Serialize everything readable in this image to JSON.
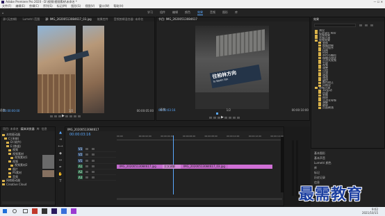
{
  "window": {
    "title": "Adobe Premiere Pro 2020 - D:\\视频\\视频素材\\未命名 *"
  },
  "menu": [
    "文件(F)",
    "编辑(E)",
    "剪辑(C)",
    "序列(S)",
    "标记(M)",
    "图形(G)",
    "视图(V)",
    "窗口(W)",
    "帮助(H)"
  ],
  "workspaces": [
    "学习",
    "组件",
    "编辑",
    "颜色",
    "效果",
    "音频",
    "图形",
    "库"
  ],
  "active_workspace": "效果",
  "source": {
    "tabs": [
      "源:(无剪辑)",
      "Lumetri 范围",
      "源: IMG_20200513084617_03.jpg",
      "效果控件",
      "音频剪辑混合器: 未命名"
    ],
    "timecode": "00:00:00:00",
    "fit": "适合",
    "ratio": "1/2",
    "end": "00:00:05:00"
  },
  "program": {
    "tab": "节目: IMG_20200513084617",
    "timecode": "00:00:03:16",
    "fit": "适合",
    "ratio": "1/2",
    "end": "00:00:10:00",
    "sign": "往柏林方向",
    "sign_sub": "to Berlin Stn"
  },
  "effects": {
    "title": "效果",
    "items": [
      "预设",
      "Lumetri 预设",
      "音频效果",
      "音频过渡",
      "视频效果",
      "变换",
      "图像控制",
      "实用程序",
      "扭曲",
      "时间",
      "杂色与颗粒",
      "模糊与锐化",
      "沉浸式视频",
      "生成",
      "视频",
      "调整",
      "过时",
      "过渡",
      "透视",
      "通道",
      "键控",
      "颜色校正",
      "风格化",
      "视频过渡",
      "3D运动",
      "内滑",
      "划像",
      "擦除",
      "沉浸式视频",
      "溶解",
      "缩放",
      "页面剥落"
    ]
  },
  "bottom_right": [
    "基本图形",
    "基本声音",
    "Lumetri 颜色",
    "库",
    "标记",
    "历史记录",
    "信息"
  ],
  "project": {
    "tabs": [
      "项目: 未命名",
      "媒体浏览器",
      "库",
      "信息"
    ],
    "tree": [
      "本地驱动器",
      "C:(系统)",
      "D:(软件)",
      "E:(数据)",
      "视频",
      "视频素材",
      "视频素材1",
      "视频",
      "视频素材2",
      "图片",
      "PS素材",
      "音频",
      "网络驱动器",
      "Creative Cloud"
    ]
  },
  "timeline": {
    "tab": "IMG_20200513084617",
    "timecode": "00:00:03:16",
    "tracks": [
      "V3",
      "V2",
      "V1",
      "A1",
      "A2",
      "A3"
    ],
    "clip1": "IMG_20200513084617.jpg",
    "transition": "交叉溶解",
    "clip2": "IMG_20200513084617_03.jpg",
    "ruler": [
      "00:00",
      "00:00:02:00",
      "00:00:04:00",
      "00:00:06:00",
      "00:00:08:00",
      "00:00:10:00",
      "00:00:12:00",
      "00:00:14:00"
    ]
  },
  "watermark": "最需教育",
  "taskbar": {
    "time": "9:02",
    "date": "2021/10/15"
  }
}
